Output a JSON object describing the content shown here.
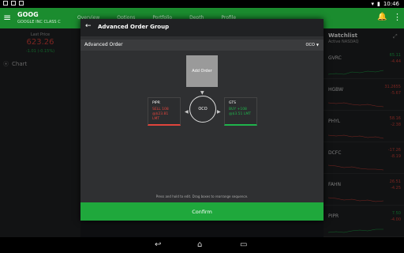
{
  "statusbar": {
    "time": "10:46"
  },
  "appbar": {
    "ticker": "GOOG",
    "company": "GOOGLE INC CLASS C",
    "tabs": [
      "Overview",
      "Options",
      "Portfolio",
      "Depth",
      "Profile"
    ]
  },
  "left": {
    "label": "Last Price",
    "price": "623.26",
    "change": "-1.01 (-0.15%)",
    "chart": "Chart"
  },
  "watchlist": {
    "title": "Watchlist",
    "subtitle": "Active NASDAQ",
    "items": [
      {
        "symbol": "GVRC",
        "price": "65.11",
        "change": "-4.44",
        "dir": "up"
      },
      {
        "symbol": "HGBW",
        "price": "31.2655",
        "change": "-5.67",
        "dir": "down"
      },
      {
        "symbol": "PHYL",
        "price": "58.16",
        "change": "-2.38",
        "dir": "down"
      },
      {
        "symbol": "DCFC",
        "price": "-17.26",
        "change": "-8.19",
        "dir": "down"
      },
      {
        "symbol": "FAHN",
        "price": "26.51",
        "change": "-4.25",
        "dir": "down"
      },
      {
        "symbol": "PIPR",
        "price": "7.50",
        "change": "-4.00",
        "dir": "up"
      }
    ]
  },
  "dialog": {
    "title": "Advanced Order Group",
    "subtitle": "Advanced Order",
    "select": "OCO",
    "add_order": "Add Order",
    "oco": "OCO",
    "order1": {
      "symbol": "PIPR",
      "line1": "SELL 108",
      "line2": "@$23.81 LMT"
    },
    "order2": {
      "symbol": "GTS",
      "line1": "BUY +108",
      "line2": "@$3.51 LMT"
    },
    "hint": "Press and hold to edit. Drag boxes to rearrange sequence.",
    "confirm": "Confirm"
  }
}
